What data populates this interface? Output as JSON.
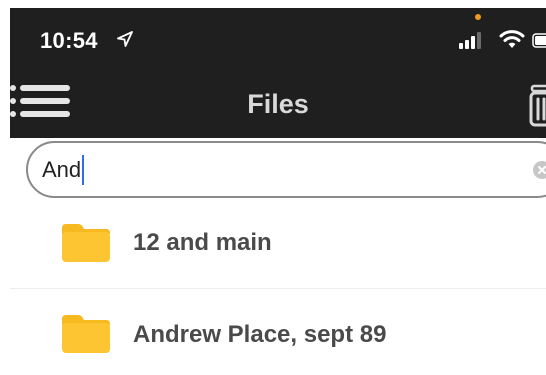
{
  "status_bar": {
    "time": "10:54",
    "location_icon": "location-arrow-icon",
    "signal_icon": "cellular-signal-icon",
    "wifi_icon": "wifi-icon",
    "battery_icon": "battery-icon",
    "privacy_dot_color": "#f29a1e"
  },
  "nav_bar": {
    "title": "Files",
    "menu_icon": "hamburger-menu-icon",
    "trash_icon": "trash-icon",
    "background": "#1f1f1f"
  },
  "search": {
    "value": "And",
    "clear_icon": "clear-circle-icon",
    "caret_color": "#2f6cf0"
  },
  "files": [
    {
      "name": "12 and main",
      "icon": "folder-icon"
    },
    {
      "name": "Andrew Place, sept 89",
      "icon": "folder-icon"
    }
  ],
  "colors": {
    "folder": "#fcc531",
    "folder_tab": "#f6b920",
    "text": "#4a4a4a"
  }
}
